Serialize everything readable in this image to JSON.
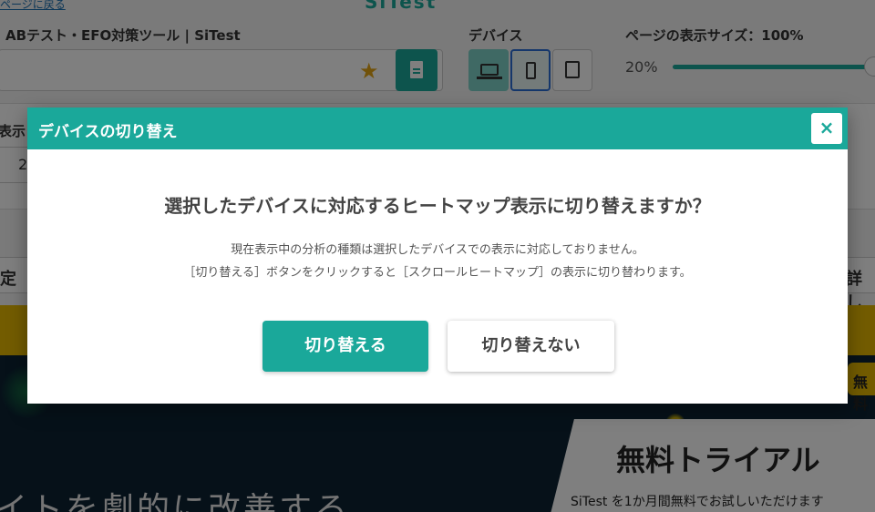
{
  "top": {
    "link_text": "ページに戻る",
    "logo_text": "SiTest"
  },
  "header": {
    "page_title": "ABテスト・EFO対策ツール | SiTest",
    "device_label": "デバイス",
    "size_label": "ページの表示サイズ：100%",
    "size_min": "20%"
  },
  "filters": {
    "label": "表示",
    "value": "2"
  },
  "actions": {
    "left_button": "定",
    "right_button": "詳し"
  },
  "site": {
    "badge": "無料",
    "trial_title": "無料トライアル",
    "trial_sub": "SiTest を1か月間無料でお試しいただけます",
    "hero_text": "イトを劇的に改善する"
  },
  "modal": {
    "title": "デバイスの切り替え",
    "close_label": "×",
    "question": "選択したデバイスに対応するヒートマップ表示に切り替えますか？",
    "desc_line1": "現在表示中の分析の種類は選択したデバイスでの表示に対応しておりません。",
    "desc_line2": "［切り替える］ボタンをクリックすると［スクロールヒートマップ］の表示に切り替わります。",
    "confirm_label": "切り替える",
    "cancel_label": "切り替えない"
  },
  "colors": {
    "accent": "#1aa89a",
    "star": "#e3a514",
    "selected_border": "#2a6fd6",
    "band": "#e6b800",
    "hero": "#0c2233"
  },
  "icons": [
    "star-icon",
    "document-icon",
    "laptop-icon",
    "smartphone-icon",
    "tablet-icon",
    "close-icon"
  ]
}
